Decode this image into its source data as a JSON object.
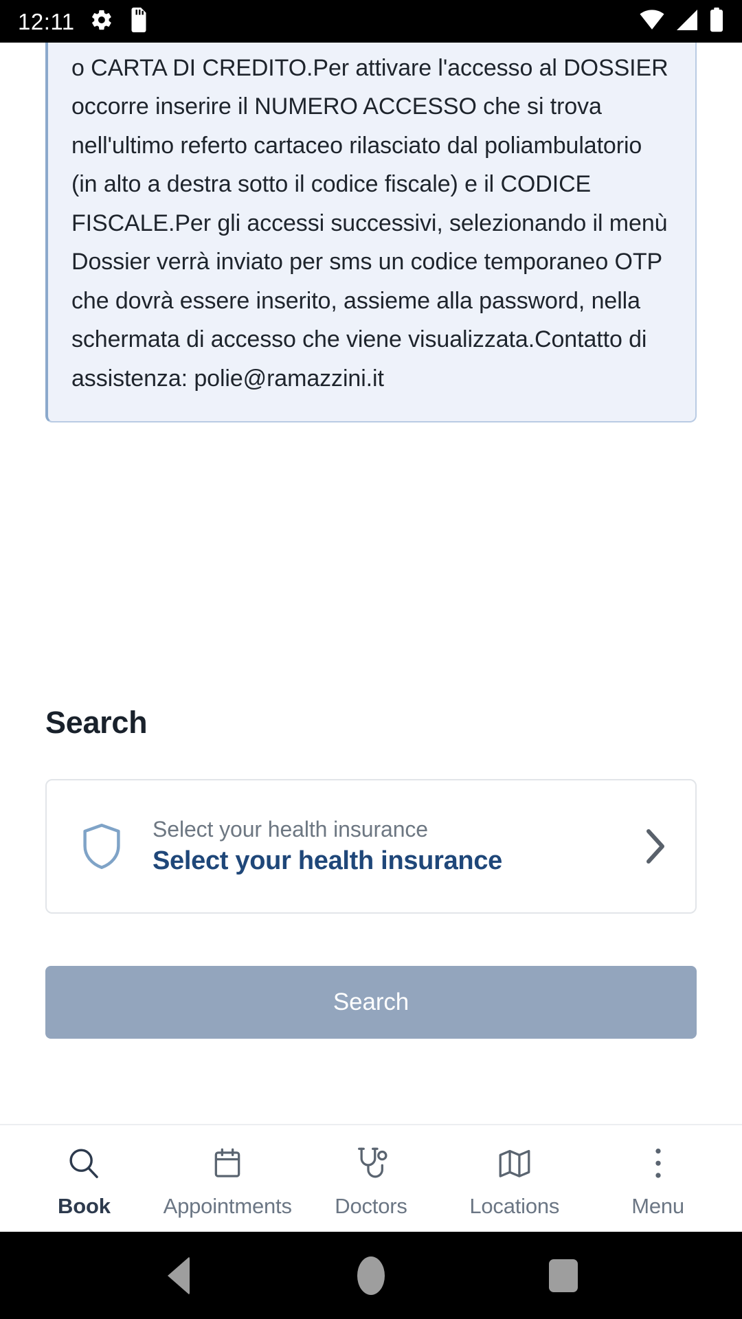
{
  "status_bar": {
    "time": "12:11",
    "left_icons": [
      "gear-icon",
      "sd-card-icon"
    ],
    "right_icons": [
      "wifi-icon",
      "cellular-signal-icon",
      "battery-icon"
    ]
  },
  "notice": {
    "text": "detraibili solo le Fatture sanitarie pagate con BANCOMAT o CARTA DI CREDITO.Per attivare l'accesso al DOSSIER occorre inserire il NUMERO ACCESSO che si trova nell'ultimo referto cartaceo rilasciato dal poliambulatorio (in alto a destra sotto il codice fiscale) e il CODICE FISCALE.Per gli accessi successivi, selezionando il menù Dossier verrà inviato per sms un codice temporaneo OTP che dovrà essere inserito, assieme alla password, nella schermata di accesso che viene visualizzata.Contatto di assistenza: polie@ramazzini.it"
  },
  "search_section": {
    "heading": "Search",
    "insurance_selector": {
      "icon": "shield-icon",
      "label": "Select your health insurance",
      "value": "Select your health insurance",
      "chevron": "chevron-right-icon"
    },
    "submit_label": "Search"
  },
  "bottom_nav": {
    "items": [
      {
        "label": "Book",
        "icon": "search-icon",
        "active": true
      },
      {
        "label": "Appointments",
        "icon": "calendar-icon",
        "active": false
      },
      {
        "label": "Doctors",
        "icon": "stethoscope-icon",
        "active": false
      },
      {
        "label": "Locations",
        "icon": "map-icon",
        "active": false
      },
      {
        "label": "Menu",
        "icon": "more-vertical-icon",
        "active": false
      }
    ]
  },
  "android_nav": {
    "back": "back-triangle-icon",
    "home": "home-circle-icon",
    "recents": "recents-square-icon"
  },
  "colors": {
    "notice_bg": "#eef2fa",
    "notice_border": "#b9cbe3",
    "accent_blue": "#1f4779",
    "icon_blue": "#7fa3c7",
    "button_disabled": "#93a5bd",
    "nav_inactive": "#6b7684",
    "nav_active": "#2d3a4d",
    "heading": "#19212b"
  }
}
